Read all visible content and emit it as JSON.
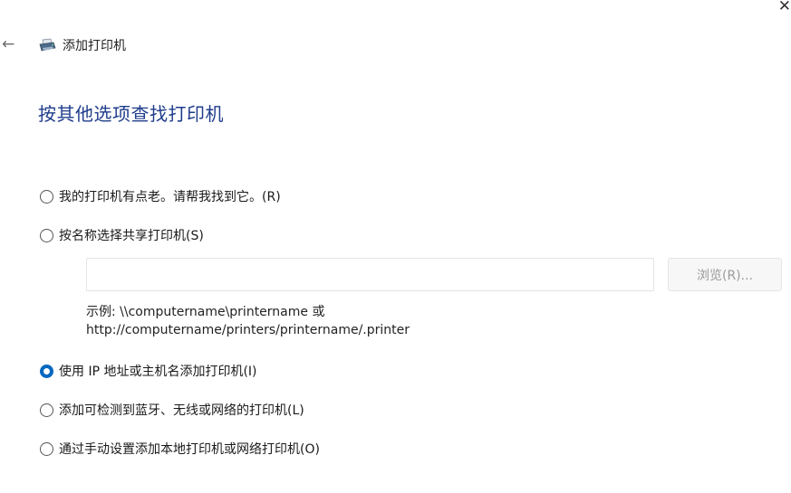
{
  "window": {
    "close_glyph": "✕",
    "back_glyph": "←",
    "title": "添加打印机",
    "title_icon": "printer-icon"
  },
  "heading": "按其他选项查找打印机",
  "options": [
    {
      "label": "我的打印机有点老。请帮我找到它。(R)",
      "checked": false
    },
    {
      "label": "按名称选择共享打印机(S)",
      "checked": false
    },
    {
      "label": "使用 IP 地址或主机名添加打印机(I)",
      "checked": true
    },
    {
      "label": "添加可检测到蓝牙、无线或网络的打印机(L)",
      "checked": false
    },
    {
      "label": "通过手动设置添加本地打印机或网络打印机(O)",
      "checked": false
    }
  ],
  "shared_printer": {
    "input_value": "",
    "browse_label": "浏览(R)...",
    "example_line1": "示例: \\\\computername\\printername 或",
    "example_line2": "http://computername/printers/printername/.printer"
  },
  "colors": {
    "heading": "#1f3d8c",
    "radio_selected": "#0067c0"
  }
}
